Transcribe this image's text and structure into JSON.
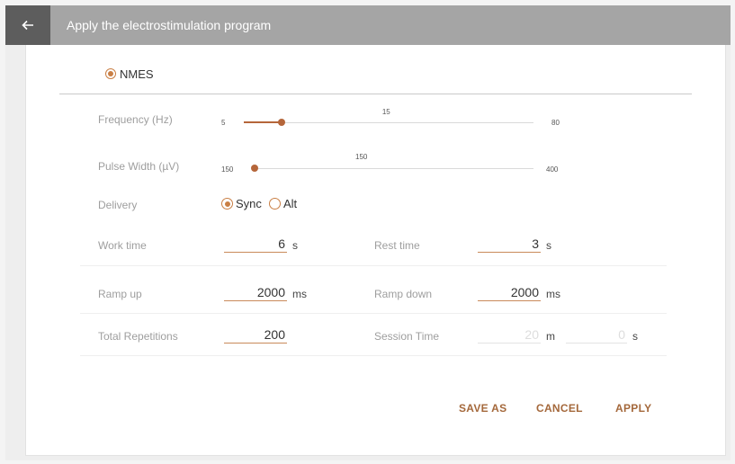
{
  "header": {
    "title": "Apply the electrostimulation program"
  },
  "mode": {
    "label": "NMES",
    "selected": true
  },
  "frequency": {
    "label": "Frequency (Hz)",
    "min": "5",
    "max": "80",
    "value": "15",
    "fraction": 0.13
  },
  "pulse_width": {
    "label": "Pulse Width (µV)",
    "min": "150",
    "max": "400",
    "value": "150",
    "fraction": 0.0
  },
  "delivery": {
    "label": "Delivery",
    "options": [
      "Sync",
      "Alt"
    ],
    "selected": "Sync"
  },
  "work_time": {
    "label": "Work time",
    "value": "6",
    "unit": "s"
  },
  "rest_time": {
    "label": "Rest time",
    "value": "3",
    "unit": "s"
  },
  "ramp_up": {
    "label": "Ramp up",
    "value": "2000",
    "unit": "ms"
  },
  "ramp_down": {
    "label": "Ramp down",
    "value": "2000",
    "unit": "ms"
  },
  "total_repetitions": {
    "label": "Total Repetitions",
    "value": "200"
  },
  "session_time": {
    "label": "Session Time",
    "minutes": "20",
    "minutes_unit": "m",
    "seconds": "0",
    "seconds_unit": "s"
  },
  "actions": {
    "save_as": "SAVE AS",
    "cancel": "CANCEL",
    "apply": "APPLY"
  },
  "colors": {
    "accent": "#b5663a",
    "titlebar": "#a5a5a5",
    "back": "#5d5d5d"
  },
  "icons": {
    "back": "arrow-left-icon"
  }
}
